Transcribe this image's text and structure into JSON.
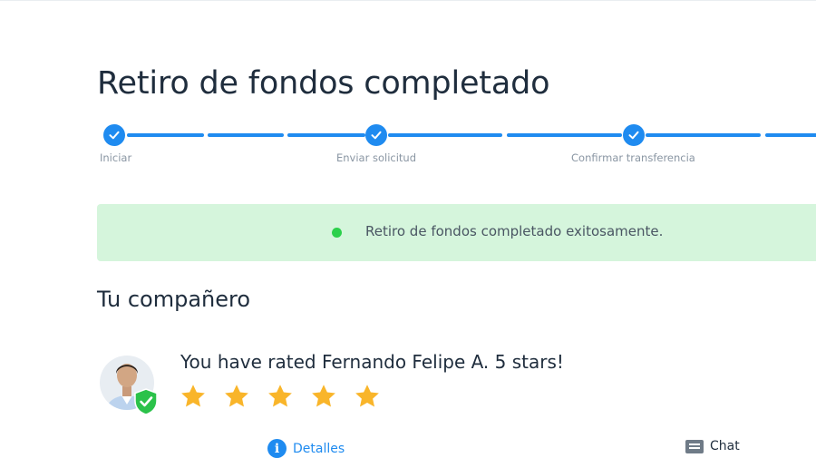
{
  "page": {
    "title": "Retiro de fondos completado"
  },
  "stepper": {
    "steps": [
      {
        "label": "Iniciar",
        "status": "completed"
      },
      {
        "label": "Enviar solicitud",
        "status": "completed"
      },
      {
        "label": "Confirmar transferencia",
        "status": "completed"
      }
    ]
  },
  "banner": {
    "message": "Retiro de fondos completado exitosamente.",
    "status_color": "#2bd04b"
  },
  "partner": {
    "section_title": "Tu compañero",
    "avatar_icon": "verified-shield-icon",
    "rated_text": "You have rated Fernando Felipe A. 5 stars!",
    "rating": 5,
    "rating_max": 5,
    "star_color": "#f9b52a"
  },
  "actions": {
    "details_label": "Detalles",
    "details_icon": "info-icon",
    "chat_label": "Chat",
    "chat_icon": "chat-icon"
  },
  "colors": {
    "accent": "#1f8bf0",
    "success_bg": "#d5f5dc"
  }
}
